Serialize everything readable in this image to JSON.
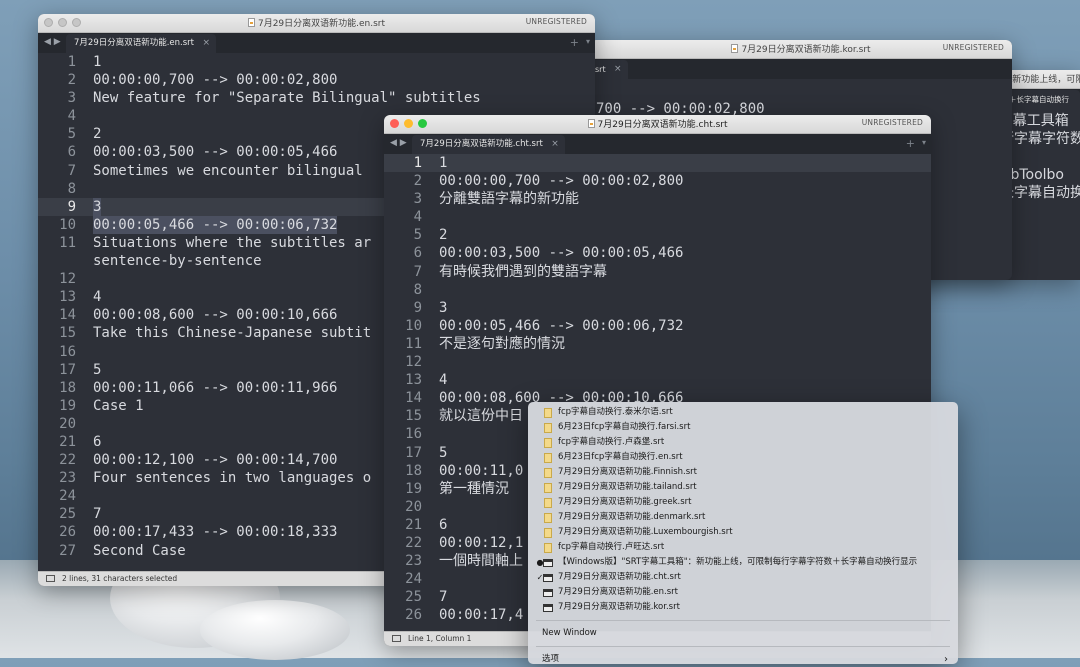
{
  "colors": {
    "editor_bg": "#2d3038",
    "gutter_text": "#8d939b",
    "text": "#d8dadf",
    "menu_bg": "#d6d9de"
  },
  "win_en": {
    "title": "7月29日分离双语新功能.en.srt",
    "registration": "UNREGISTERED",
    "tab_label": "7月29日分离双语新功能.en.srt",
    "status": "2 lines, 31 characters selected",
    "lines": [
      {
        "n": "1",
        "t": "1"
      },
      {
        "n": "2",
        "t": "00:00:00,700 --> 00:00:02,800"
      },
      {
        "n": "3",
        "t": "New feature for \"Separate Bilingual\" subtitles"
      },
      {
        "n": "4",
        "t": ""
      },
      {
        "n": "5",
        "t": "2"
      },
      {
        "n": "6",
        "t": "00:00:03,500 --> 00:00:05,466"
      },
      {
        "n": "7",
        "t": "Sometimes we encounter bilingual"
      },
      {
        "n": "8",
        "t": ""
      },
      {
        "n": "9",
        "t": "3"
      },
      {
        "n": "10",
        "t": "00:00:05,466 --> 00:00:06,732"
      },
      {
        "n": "11",
        "t": "Situations where the subtitles ar"
      },
      {
        "n": "",
        "t": "sentence-by-sentence"
      },
      {
        "n": "12",
        "t": ""
      },
      {
        "n": "13",
        "t": "4"
      },
      {
        "n": "14",
        "t": "00:00:08,600 --> 00:00:10,666"
      },
      {
        "n": "15",
        "t": "Take this Chinese-Japanese subtit"
      },
      {
        "n": "16",
        "t": ""
      },
      {
        "n": "17",
        "t": "5"
      },
      {
        "n": "18",
        "t": "00:00:11,066 --> 00:00:11,966"
      },
      {
        "n": "19",
        "t": "Case 1"
      },
      {
        "n": "20",
        "t": ""
      },
      {
        "n": "21",
        "t": "6"
      },
      {
        "n": "22",
        "t": "00:00:12,100 --> 00:00:14,700"
      },
      {
        "n": "23",
        "t": "Four sentences in two languages o"
      },
      {
        "n": "24",
        "t": ""
      },
      {
        "n": "25",
        "t": "7"
      },
      {
        "n": "26",
        "t": "00:00:17,433 --> 00:00:18,333"
      },
      {
        "n": "27",
        "t": "Second Case"
      }
    ]
  },
  "win_kor": {
    "title": "7月29日分离双语新功能.kor.srt",
    "registration": "UNREGISTERED",
    "tab_label": "srt",
    "visible_text": "700 --> 00:00:02,800"
  },
  "win_win": {
    "title": "【Windows版】\"SRT字幕工具箱\"：新功能上线，可限",
    "tab_label": "幕工具箱\"：新功能上线，可限制每行字幕字符数＋长字幕自动换行显示",
    "lines": [
      "s版】“SRT字幕工具箱",
      "，可限制每行字幕字符数",
      "行显示",
      "s版】“SrtSubToolbo",
      "字幕字符数长字幕自动换"
    ]
  },
  "win_cht": {
    "title": "7月29日分离双语新功能.cht.srt",
    "registration": "UNREGISTERED",
    "tab_label": "7月29日分离双语新功能.cht.srt",
    "status": "Line 1, Column 1",
    "lines": [
      {
        "n": "1",
        "t": "1"
      },
      {
        "n": "2",
        "t": "00:00:00,700 --> 00:00:02,800"
      },
      {
        "n": "3",
        "t": "分離雙語字幕的新功能"
      },
      {
        "n": "4",
        "t": ""
      },
      {
        "n": "5",
        "t": "2"
      },
      {
        "n": "6",
        "t": "00:00:03,500 --> 00:00:05,466"
      },
      {
        "n": "7",
        "t": "有時候我們遇到的雙語字幕"
      },
      {
        "n": "8",
        "t": ""
      },
      {
        "n": "9",
        "t": "3"
      },
      {
        "n": "10",
        "t": "00:00:05,466 --> 00:00:06,732"
      },
      {
        "n": "11",
        "t": "不是逐句對應的情況"
      },
      {
        "n": "12",
        "t": ""
      },
      {
        "n": "13",
        "t": "4"
      },
      {
        "n": "14",
        "t": "00:00:08,600 --> 00:00:10,666"
      },
      {
        "n": "15",
        "t": "就以這份中日"
      },
      {
        "n": "16",
        "t": ""
      },
      {
        "n": "17",
        "t": "5"
      },
      {
        "n": "18",
        "t": "00:00:11,0"
      },
      {
        "n": "19",
        "t": "第一種情況"
      },
      {
        "n": "20",
        "t": ""
      },
      {
        "n": "21",
        "t": "6"
      },
      {
        "n": "22",
        "t": "00:00:12,1"
      },
      {
        "n": "23",
        "t": "一個時間軸上"
      },
      {
        "n": "24",
        "t": ""
      },
      {
        "n": "25",
        "t": "7"
      },
      {
        "n": "26",
        "t": "00:00:17,4"
      }
    ]
  },
  "menu": {
    "recent_files": [
      "fcp字幕自动换行.泰米尔语.srt",
      "6月23日fcp字幕自动换行.farsi.srt",
      "fcp字幕自动换行.卢森堡.srt",
      "6月23日fcp字幕自动换行.en.srt",
      "7月29日分离双语新功能.Finnish.srt",
      "7月29日分离双语新功能.tailand.srt",
      "7月29日分离双语新功能.greek.srt",
      "7月29日分离双语新功能.denmark.srt",
      "7月29日分离双语新功能.Luxembourgish.srt",
      "fcp字幕自动换行.卢旺达.srt"
    ],
    "open_windows": [
      {
        "label": "【Windows版】\"SRT字幕工具箱\"：新功能上线，可限制每行字幕字符数＋长字幕自动换行显示",
        "mark": "●"
      },
      {
        "label": "7月29日分离双语新功能.cht.srt",
        "mark": "✓"
      },
      {
        "label": "7月29日分离双语新功能.en.srt",
        "mark": ""
      },
      {
        "label": "7月29日分离双语新功能.kor.srt",
        "mark": ""
      }
    ],
    "new_window": "New Window",
    "options": "选项",
    "options_arrow": "›"
  }
}
